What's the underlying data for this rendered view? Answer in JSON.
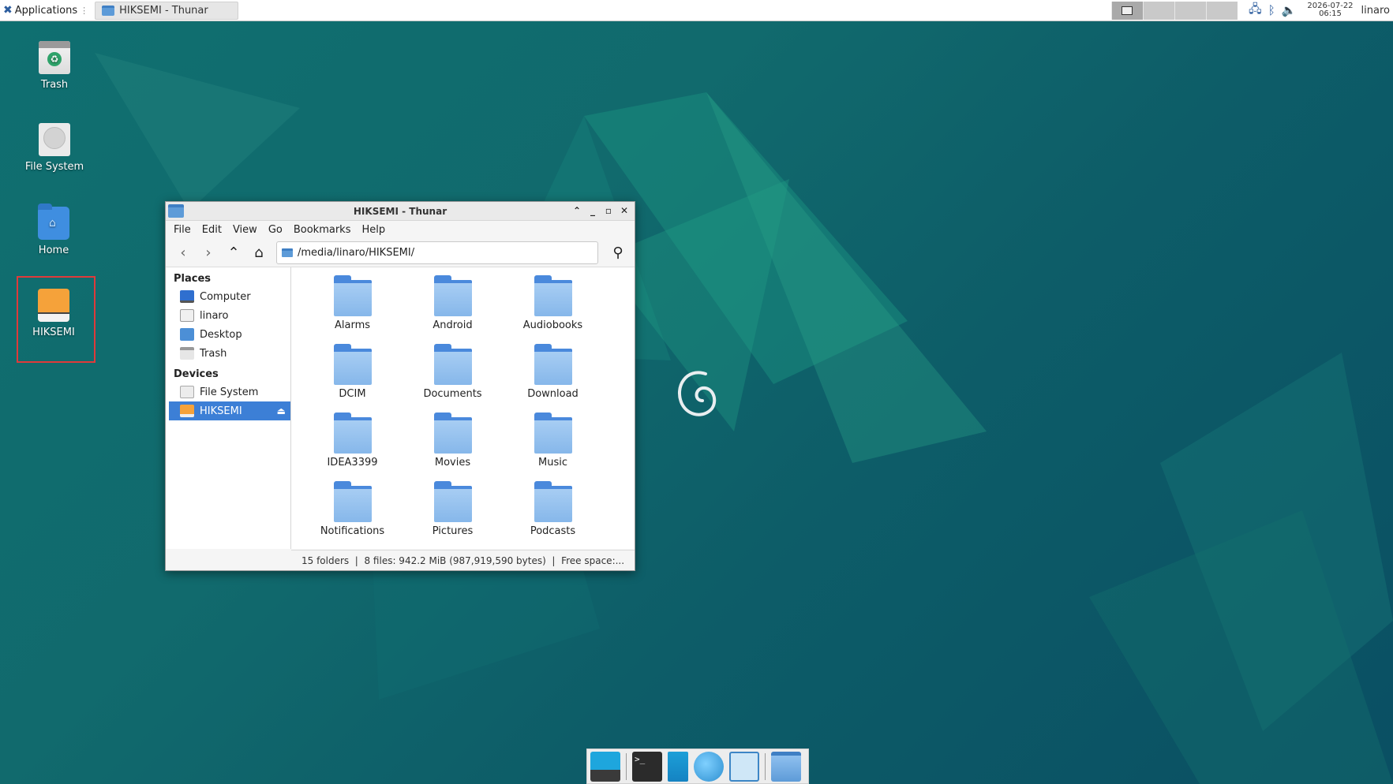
{
  "top_panel": {
    "applications_label": "Applications",
    "task_title": "HIKSEMI - Thunar",
    "clock_date": "2026-07-22",
    "clock_time": "06:15",
    "user": "linaro",
    "tray_icons": [
      "network-icon",
      "bluetooth-icon",
      "volume-icon"
    ]
  },
  "desktop": {
    "icons": [
      {
        "label": "Trash",
        "icon": "trash-icon"
      },
      {
        "label": "File System",
        "icon": "drive-icon"
      },
      {
        "label": "Home",
        "icon": "home-folder-icon"
      },
      {
        "label": "HIKSEMI",
        "icon": "usb-drive-icon",
        "selected": true
      }
    ]
  },
  "window": {
    "title": "HIKSEMI - Thunar",
    "menu": [
      "File",
      "Edit",
      "View",
      "Go",
      "Bookmarks",
      "Help"
    ],
    "location": "/media/linaro/HIKSEMI/",
    "sidebar": {
      "places_heading": "Places",
      "places": [
        "Computer",
        "linaro",
        "Desktop",
        "Trash"
      ],
      "devices_heading": "Devices",
      "devices": [
        "File System",
        "HIKSEMI"
      ]
    },
    "files": [
      "Alarms",
      "Android",
      "Audiobooks",
      "DCIM",
      "Documents",
      "Download",
      "IDEA3399",
      "Movies",
      "Music",
      "Notifications",
      "Pictures",
      "Podcasts"
    ],
    "status": "15 folders  |  8 files: 942.2 MiB (987,919,590 bytes)  |  Free space:..."
  },
  "dock": {
    "items": [
      "show-desktop-icon",
      "terminal-icon",
      "file-manager-icon",
      "web-browser-icon",
      "app-finder-icon",
      "folder-icon"
    ],
    "terminal_glyph": ">_"
  }
}
